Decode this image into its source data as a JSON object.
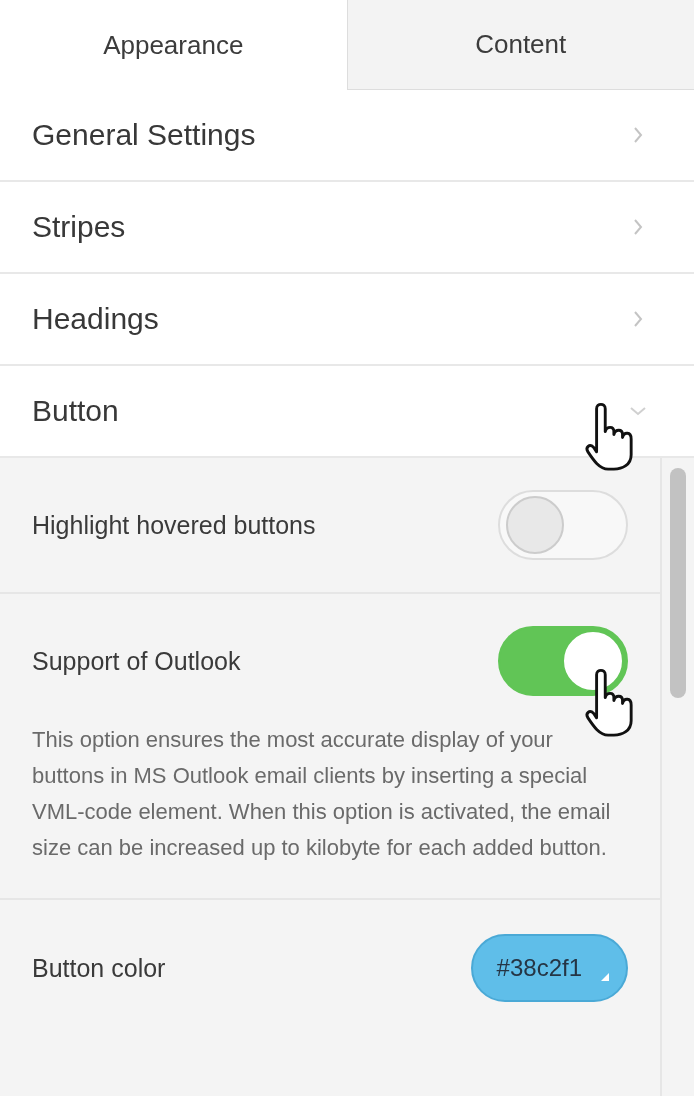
{
  "tabs": [
    {
      "label": "Appearance",
      "selected": true
    },
    {
      "label": "Content",
      "selected": false
    }
  ],
  "sections": [
    {
      "title": "General Settings",
      "expanded": false
    },
    {
      "title": "Stripes",
      "expanded": false
    },
    {
      "title": "Headings",
      "expanded": false
    },
    {
      "title": "Button",
      "expanded": true
    }
  ],
  "settings": [
    {
      "kind": "toggle",
      "label": "Highlight hovered buttons",
      "on": false
    },
    {
      "kind": "toggle",
      "label": "Support of Outlook",
      "on": true,
      "description": "This option ensures the most accurate display of your buttons in MS Outlook email clients by inserting a special VML-code element. When this option is activated, the email size can be increased up to kilobyte for each added button."
    },
    {
      "kind": "color",
      "label": "Button color",
      "value": "#38c2f1"
    }
  ]
}
